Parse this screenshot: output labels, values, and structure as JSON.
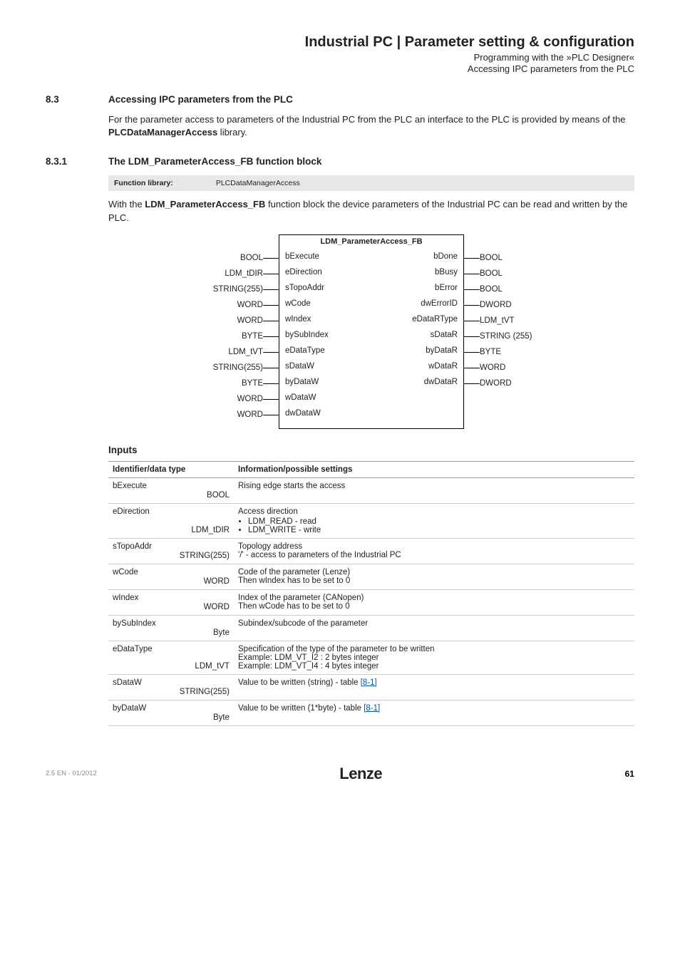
{
  "header": {
    "title": "Industrial PC | Parameter setting & configuration",
    "sub1": "Programming with the »PLC Designer«",
    "sub2": "Accessing IPC parameters from the PLC"
  },
  "section83": {
    "num": "8.3",
    "title": "Accessing IPC parameters from the PLC",
    "para1a": "For the parameter access to parameters of the Industrial PC from the PLC an interface to the PLC is provided by means of the ",
    "para1b_strong": "PLCDataManagerAccess",
    "para1c": " library."
  },
  "section831": {
    "num": "8.3.1",
    "title": "The LDM_ParameterAccess_FB function block",
    "fn_lib_label": "Function library:",
    "fn_lib_value": "PLCDataManagerAccess",
    "para1a": "With the ",
    "para1b_strong": "LDM_ParameterAccess_FB",
    "para1c": " function block the device parameters of the Industrial PC can be read and written by the PLC."
  },
  "fb": {
    "title": "LDM_ParameterAccess_FB",
    "left_types": [
      "BOOL",
      "LDM_tDIR",
      "STRING(255)",
      "WORD",
      "WORD",
      "BYTE",
      "LDM_tVT",
      "STRING(255)",
      "BYTE",
      "WORD",
      "WORD"
    ],
    "left_names": [
      "bExecute",
      "eDirection",
      "sTopoAddr",
      "wCode",
      "wIndex",
      "bySubIndex",
      "eDataType",
      "sDataW",
      "byDataW",
      "wDataW",
      "dwDataW"
    ],
    "right_names": [
      "bDone",
      "bBusy",
      "bError",
      "dwErrorID",
      "eDataRType",
      "sDataR",
      "byDataR",
      "wDataR",
      "dwDataR"
    ],
    "right_types": [
      "BOOL",
      "BOOL",
      "BOOL",
      "DWORD",
      "LDM_tVT",
      "STRING (255)",
      "BYTE",
      "WORD",
      "DWORD"
    ]
  },
  "inputs_table": {
    "heading": "Inputs",
    "col1": "Identifier/data type",
    "col2": "Information/possible settings",
    "rows": [
      {
        "id": "bExecute",
        "type": "BOOL",
        "info_lines": [
          "Rising edge starts the access"
        ]
      },
      {
        "id": "eDirection",
        "type": "LDM_tDIR",
        "info_lines": [
          "Access direction"
        ],
        "bullets": [
          "LDM_READ - read",
          "LDM_WRITE - write"
        ]
      },
      {
        "id": "sTopoAddr",
        "type": "STRING(255)",
        "info_lines": [
          "Topology address",
          "'/' - access to parameters of the Industrial PC"
        ]
      },
      {
        "id": "wCode",
        "type": "WORD",
        "info_lines": [
          "Code of the parameter (Lenze)",
          "Then wIndex has to be set to 0"
        ]
      },
      {
        "id": "wIndex",
        "type": "WORD",
        "info_lines": [
          "Index of the parameter (CANopen)",
          "Then wCode has to be set to 0"
        ]
      },
      {
        "id": "bySubIndex",
        "type": "Byte",
        "info_lines": [
          "Subindex/subcode of the parameter"
        ]
      },
      {
        "id": "eDataType",
        "type": "LDM_tVT",
        "info_lines": [
          "Specification of the type of the parameter to be written",
          "Example: LDM_VT_I2 : 2 bytes integer",
          "Example: LDM_VT_I4 : 4 bytes integer"
        ]
      },
      {
        "id": "sDataW",
        "type": "STRING(255)",
        "info_link_prefix": "Value to be written (string) - table ",
        "info_link": "[8-1]",
        "tall": true
      },
      {
        "id": "byDataW",
        "type": "Byte",
        "info_link_prefix": "Value to be written  (1*byte) - table ",
        "info_link": "[8-1]",
        "tall": true
      }
    ]
  },
  "footer": {
    "version": "2.5 EN - 01/2012",
    "brand": "Lenze",
    "page": "61"
  }
}
